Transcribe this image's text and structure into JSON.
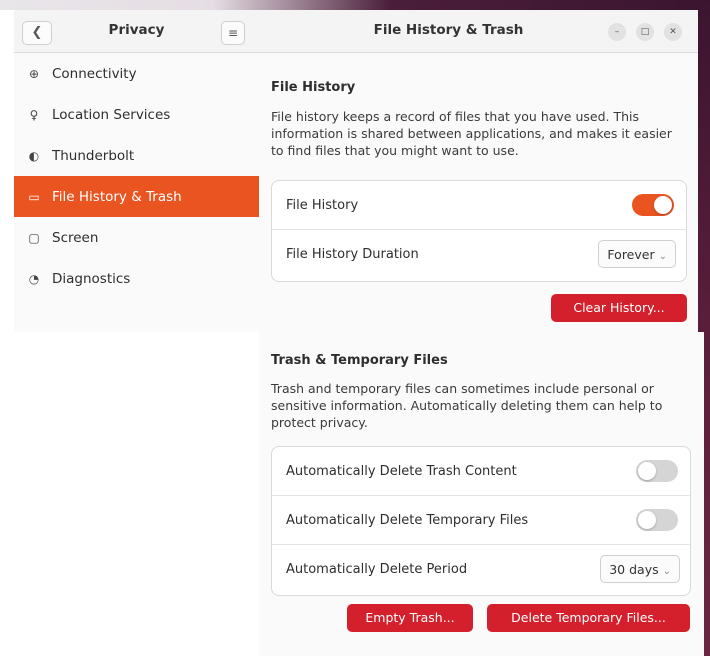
{
  "sidebar": {
    "title": "Privacy",
    "back_icon": "chevron-left-icon",
    "menu_icon": "hamburger-menu-icon",
    "items": [
      {
        "label": "Connectivity",
        "icon": "connectivity-icon",
        "glyph": "⊕"
      },
      {
        "label": "Location Services",
        "icon": "location-pin-icon",
        "glyph": "♀"
      },
      {
        "label": "Thunderbolt",
        "icon": "thunderbolt-icon",
        "glyph": "◐"
      },
      {
        "label": "File History & Trash",
        "icon": "folder-icon",
        "glyph": "▭",
        "active": true
      },
      {
        "label": "Screen",
        "icon": "screen-icon",
        "glyph": "▢"
      },
      {
        "label": "Diagnostics",
        "icon": "diagnostics-icon",
        "glyph": "◔"
      }
    ]
  },
  "window": {
    "title": "File History & Trash",
    "controls": [
      "minimize-icon",
      "maximize-icon",
      "close-icon"
    ]
  },
  "file_history": {
    "heading": "File History",
    "description": "File history keeps a record of files that you have used. This information is shared between applications, and makes it easier to find files that you might want to use.",
    "toggle_label": "File History",
    "toggle_on": true,
    "duration_label": "File History Duration",
    "duration_value": "Forever",
    "clear_button": "Clear History..."
  },
  "trash": {
    "heading": "Trash & Temporary Files",
    "description": "Trash and temporary files can sometimes include personal or sensitive information. Automatically deleting them can help to protect privacy.",
    "auto_trash_label": "Automatically Delete Trash Content",
    "auto_trash_on": false,
    "auto_temp_label": "Automatically Delete Temporary Files",
    "auto_temp_on": false,
    "period_label": "Automatically Delete Period",
    "period_value": "30 days",
    "empty_button": "Empty Trash...",
    "delete_temp_button": "Delete Temporary Files..."
  },
  "colors": {
    "accent": "#e95420",
    "destructive": "#d4202c"
  }
}
